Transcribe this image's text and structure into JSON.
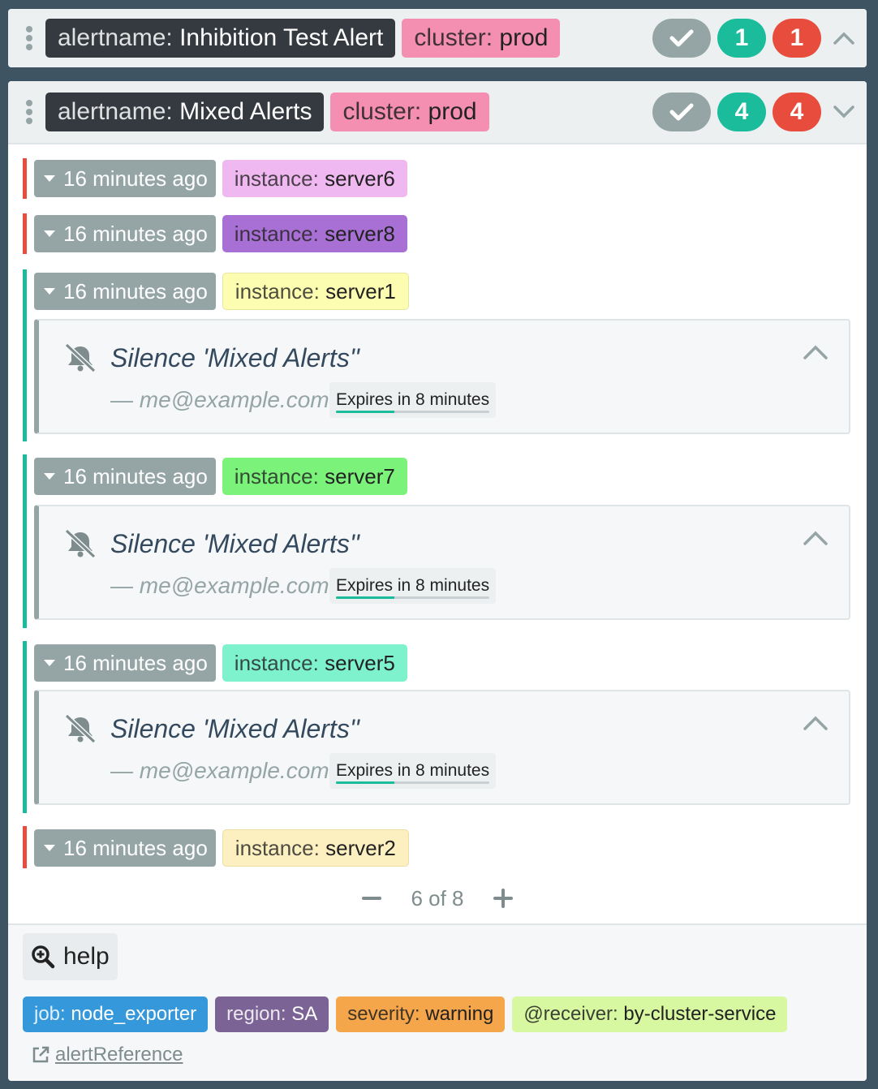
{
  "group1": {
    "labels": [
      {
        "key": "alertname:",
        "value": "Inhibition Test Alert"
      },
      {
        "key": "cluster:",
        "value": "prod"
      }
    ],
    "counts": {
      "active": "1",
      "firing": "1"
    }
  },
  "group2": {
    "labels": [
      {
        "key": "alertname:",
        "value": "Mixed Alerts"
      },
      {
        "key": "cluster:",
        "value": "prod"
      }
    ],
    "counts": {
      "active": "4",
      "firing": "4"
    },
    "alerts": [
      {
        "time": "16 minutes ago",
        "key": "instance:",
        "value": "server6",
        "color": "#f0b8f0",
        "state": "firing"
      },
      {
        "time": "16 minutes ago",
        "key": "instance:",
        "value": "server8",
        "color": "#a86fd4",
        "state": "firing"
      },
      {
        "time": "16 minutes ago",
        "key": "instance:",
        "value": "server1",
        "color": "#fdfdb2",
        "state": "suppressed",
        "silence": {
          "title": "Silence 'Mixed Alerts''",
          "author": "— me@example.com",
          "expires": "Expires in 8 minutes",
          "progress": 0.38
        }
      },
      {
        "time": "16 minutes ago",
        "key": "instance:",
        "value": "server7",
        "color": "#7bf27a",
        "state": "suppressed",
        "silence": {
          "title": "Silence 'Mixed Alerts''",
          "author": "— me@example.com",
          "expires": "Expires in 8 minutes",
          "progress": 0.38
        }
      },
      {
        "time": "16 minutes ago",
        "key": "instance:",
        "value": "server5",
        "color": "#7ef2cc",
        "state": "suppressed",
        "silence": {
          "title": "Silence 'Mixed Alerts''",
          "author": "— me@example.com",
          "expires": "Expires in 8 minutes",
          "progress": 0.38
        }
      },
      {
        "time": "16 minutes ago",
        "key": "instance:",
        "value": "server2",
        "color": "#fdf0c0",
        "state": "firing"
      }
    ],
    "pager": {
      "text": "6 of 8"
    },
    "footer": {
      "help": "help",
      "labels": [
        {
          "key": "job:",
          "value": "node_exporter",
          "bg": "#3498db",
          "fg": "#ffffff"
        },
        {
          "key": "region:",
          "value": "SA",
          "bg": "#7b6396",
          "fg": "#ffffff"
        },
        {
          "key": "severity:",
          "value": "warning",
          "bg": "#f5a54a",
          "fg": "#222222"
        },
        {
          "key": "@receiver:",
          "value": "by-cluster-service",
          "bg": "#d7f7a1",
          "fg": "#222222"
        }
      ],
      "alert_reference": "alertReference"
    }
  }
}
